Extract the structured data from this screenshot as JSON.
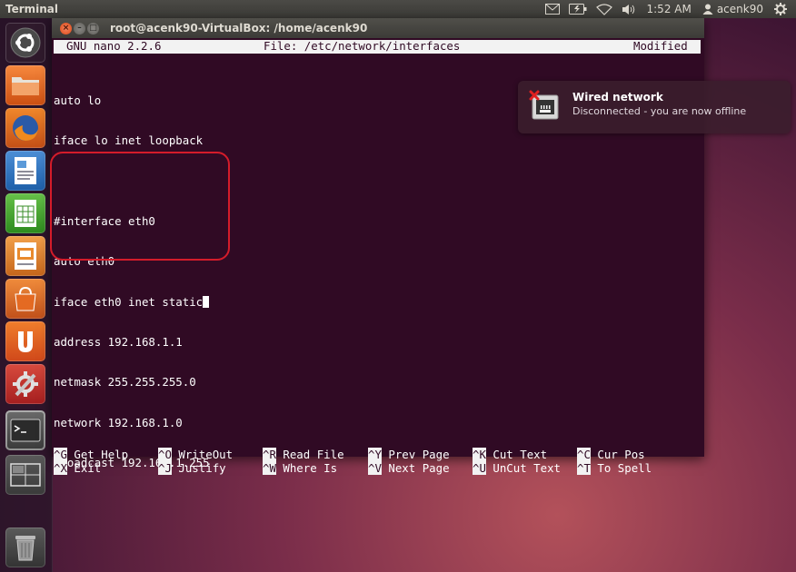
{
  "top_panel": {
    "app_title": "Terminal",
    "clock": "1:52 AM",
    "user": "acenk90",
    "icons": [
      "mail-icon",
      "battery-icon",
      "network-icon",
      "volume-icon",
      "user-icon",
      "gear-icon"
    ]
  },
  "launcher": {
    "items": [
      "ubuntu-dash-icon",
      "home-folder-icon",
      "firefox-icon",
      "libreoffice-writer-icon",
      "libreoffice-calc-icon",
      "libreoffice-impress-icon",
      "software-center-icon",
      "ubuntu-one-icon",
      "system-settings-icon",
      "terminal-icon",
      "workspace-switcher-icon",
      "trash-icon"
    ]
  },
  "window": {
    "title": "root@acenk90-VirtualBox: /home/acenk90"
  },
  "nano": {
    "version": "GNU nano 2.2.6",
    "file": "File: /etc/network/interfaces",
    "status": "Modified",
    "lines": [
      "auto lo",
      "iface lo inet loopback",
      "",
      "#interface eth0",
      "auto eth0",
      "iface eth0 inet static",
      "address 192.168.1.1",
      "netmask 255.255.255.0",
      "network 192.168.1.0",
      "broadcast 192.168.1.255"
    ],
    "shortcuts_row1": [
      {
        "key": "^G",
        "label": "Get Help"
      },
      {
        "key": "^O",
        "label": "WriteOut"
      },
      {
        "key": "^R",
        "label": "Read File"
      },
      {
        "key": "^Y",
        "label": "Prev Page"
      },
      {
        "key": "^K",
        "label": "Cut Text"
      },
      {
        "key": "^C",
        "label": "Cur Pos"
      }
    ],
    "shortcuts_row2": [
      {
        "key": "^X",
        "label": "Exit"
      },
      {
        "key": "^J",
        "label": "Justify"
      },
      {
        "key": "^W",
        "label": "Where Is"
      },
      {
        "key": "^V",
        "label": "Next Page"
      },
      {
        "key": "^U",
        "label": "UnCut Text"
      },
      {
        "key": "^T",
        "label": "To Spell"
      }
    ]
  },
  "notification": {
    "title": "Wired network",
    "body": "Disconnected - you are now offline",
    "icon": "wired-network-disconnected-icon"
  },
  "colors": {
    "terminal_bg": "#300a24",
    "highlight_border": "#d41c2a",
    "close_button": "#df4a16"
  }
}
